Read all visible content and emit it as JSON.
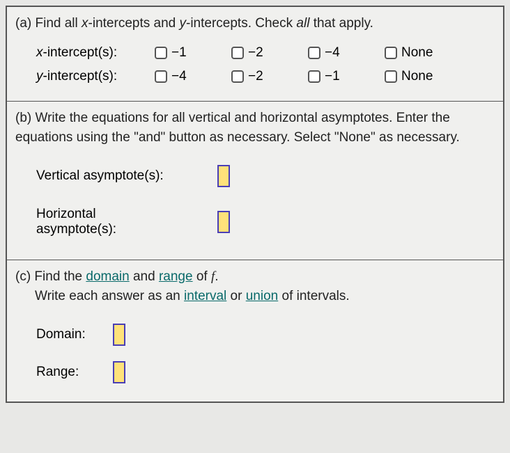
{
  "a": {
    "prompt_pre": "(a) Find all ",
    "prompt_x": "x",
    "prompt_mid1": "-intercepts and ",
    "prompt_y": "y",
    "prompt_mid2": "-intercepts. Check ",
    "prompt_all": "all",
    "prompt_end": " that apply.",
    "x_label_var": "x",
    "x_label_rest": "-intercept(s):",
    "y_label_var": "y",
    "y_label_rest": "-intercept(s):",
    "x_opts": [
      "−1",
      "−2",
      "−4",
      "None"
    ],
    "y_opts": [
      "−4",
      "−2",
      "−1",
      "None"
    ]
  },
  "b": {
    "prompt": "(b) Write the equations for all vertical and horizontal asymptotes. Enter the equations using the \"and\" button as necessary. Select \"None\" as necessary.",
    "vert_label": "Vertical asymptote(s):",
    "horiz_label1": "Horizontal",
    "horiz_label2": "asymptote(s):"
  },
  "c": {
    "prompt_pre": "(c) Find the ",
    "domain_link": "domain",
    "prompt_and": " and ",
    "range_link": "range",
    "prompt_of": " of ",
    "f": "f",
    "period": ".",
    "prompt_line2a": "Write each answer as an ",
    "interval_link": "interval",
    "prompt_or": " or ",
    "union_link": "union",
    "prompt_line2b": " of intervals.",
    "domain_label": "Domain:",
    "range_label": "Range:"
  }
}
